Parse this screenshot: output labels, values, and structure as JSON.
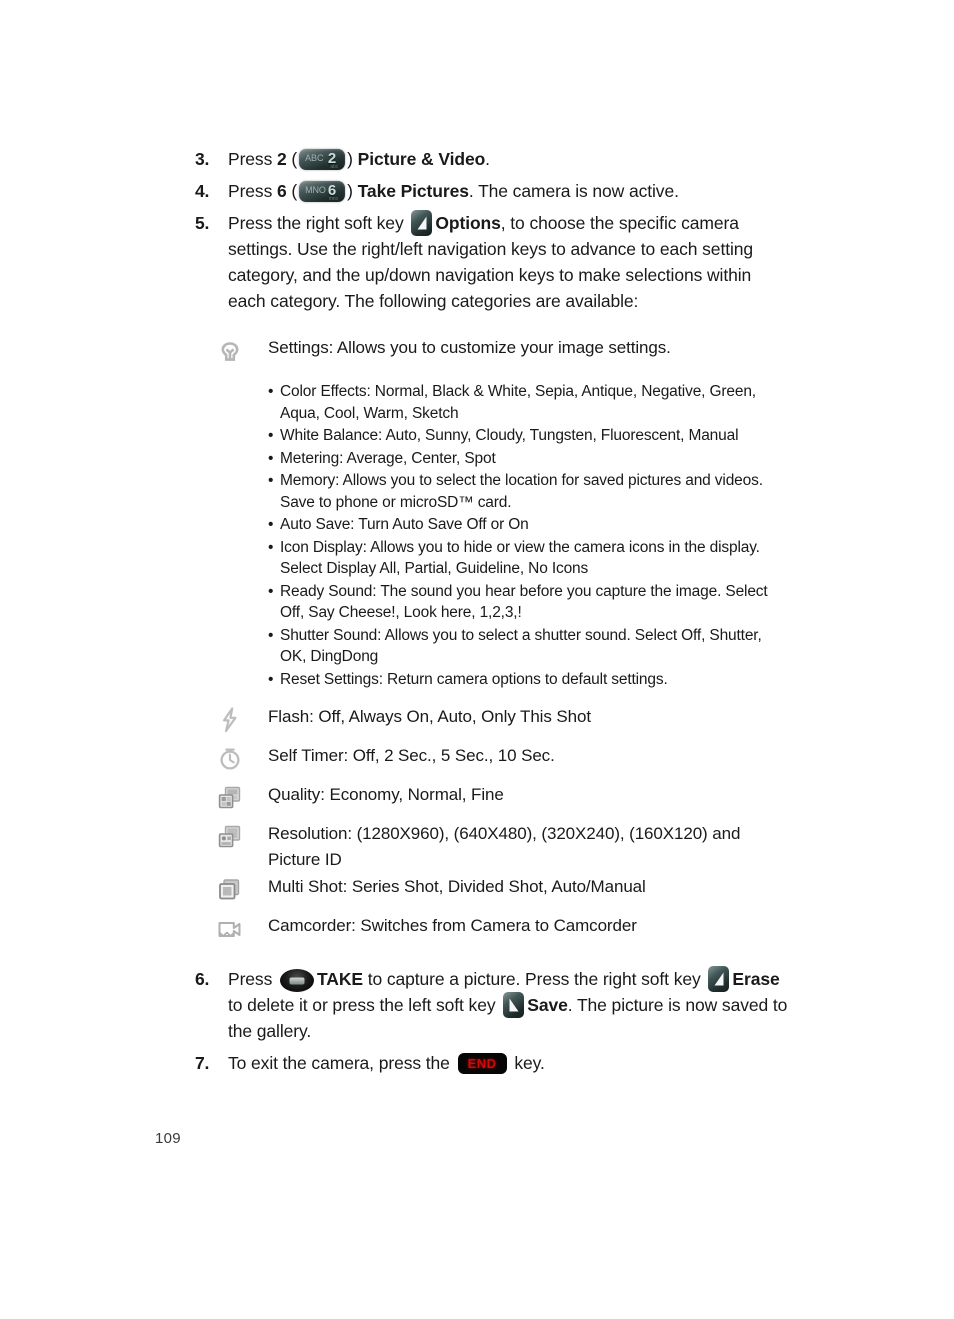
{
  "page": {
    "number": "109"
  },
  "steps": [
    {
      "num": "3.",
      "pre": "Press ",
      "bold1": "2",
      "mid": " (",
      "key": {
        "letters": "ABC",
        "digit": "2",
        "type": "keypad-key"
      },
      "post_paren": ") ",
      "bold2": "Picture & Video",
      "tail": "."
    },
    {
      "num": "4.",
      "pre": "Press ",
      "bold1": "6",
      "mid": " (",
      "key": {
        "letters": "MNO",
        "digit": "6",
        "type": "keypad-key"
      },
      "post_paren": ") ",
      "bold2": "Take Pictures",
      "tail": ". The camera is now active."
    },
    {
      "num": "5.",
      "pre": "Press the right soft key ",
      "key": {
        "type": "softkey-right"
      },
      "bold2": "Options",
      "tail": ", to choose the specific camera settings. Use the right/left navigation keys to advance to each setting category, and the up/down navigation keys to make selections within each category. The following categories are available:"
    }
  ],
  "settings": {
    "icon": "lightbulb-icon",
    "heading": "Settings:  Allows you to customize your image settings.",
    "bullet_marker": "•",
    "bullets": [
      "Color Effects: Normal, Black & White, Sepia, Antique, Negative, Green, Aqua, Cool, Warm, Sketch",
      "White Balance: Auto, Sunny, Cloudy, Tungsten, Fluorescent, Manual",
      "Metering: Average, Center, Spot",
      "Memory: Allows you to select the location for saved pictures and videos. Save to phone or microSD™ card.",
      "Auto Save: Turn Auto Save Off or On",
      "Icon Display: Allows you to hide or view the camera icons in the display. Select Display All, Partial, Guideline, No Icons",
      "Ready Sound: The sound you hear before you capture the image. Select Off, Say Cheese!, Look here, 1,2,3,!",
      "Shutter Sound: Allows you to select a shutter sound.  Select Off, Shutter, OK, DingDong",
      "Reset Settings: Return camera options to default settings."
    ]
  },
  "icon_rows": [
    {
      "icon": "flash-icon",
      "text": "Flash: Off, Always On, Auto, Only This Shot"
    },
    {
      "icon": "self-timer-icon",
      "text": "Self Timer: Off, 2 Sec., 5 Sec., 10 Sec."
    },
    {
      "icon": "quality-icon",
      "text": "Quality: Economy, Normal, Fine"
    },
    {
      "icon": "resolution-icon",
      "text": "Resolution: (1280X960), (640X480), (320X240), (160X120) and Picture ID"
    },
    {
      "icon": "multi-shot-icon",
      "text": "Multi Shot: Series Shot, Divided Shot, Auto/Manual"
    },
    {
      "icon": "camcorder-icon",
      "text": "Camcorder: Switches from Camera to Camcorder"
    }
  ],
  "steps_end": [
    {
      "num": "6.",
      "p1": "Press ",
      "take_label": "TAKE",
      "p2": " to capture a picture. Press the right soft key ",
      "erase_label": "Erase",
      "p3": " to delete it or press the left soft key ",
      "save_label": "Save",
      "p4": ". The picture is now saved to the gallery."
    },
    {
      "num": "7.",
      "p1": "To exit the camera, press the ",
      "end_label": "END",
      "p2": " key."
    }
  ],
  "colors": {
    "text": "#1a1a1a",
    "key_dark": "#21312f",
    "end_red": "#cc0b0b",
    "icon_gray": "#b4b4b4"
  }
}
